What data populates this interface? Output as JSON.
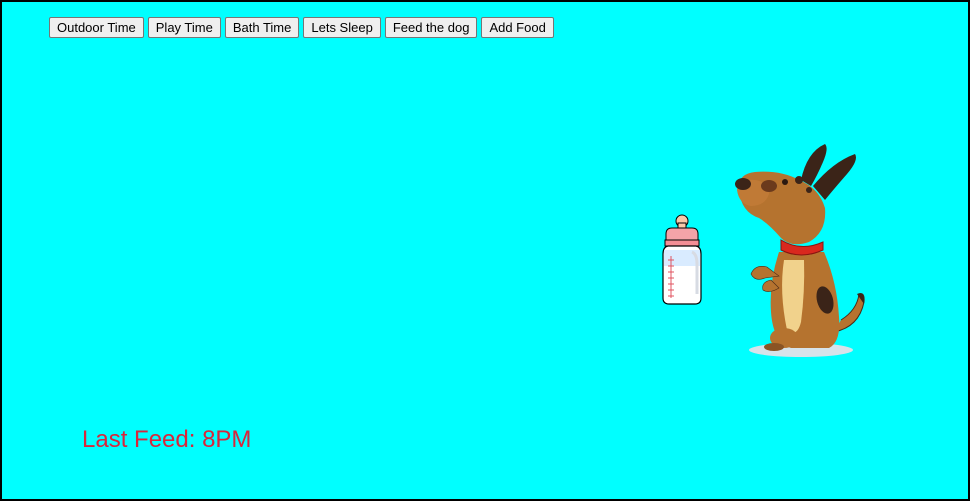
{
  "toolbar": {
    "buttons": [
      "Outdoor Time",
      "Play Time",
      "Bath Time",
      "Lets Sleep",
      "Feed the dog",
      "Add Food"
    ]
  },
  "status": {
    "last_feed": "Last Feed: 8PM"
  },
  "images": {
    "bottle": "milk-bottle-icon",
    "dog": "dog-illustration"
  },
  "colors": {
    "background": "#00ffff",
    "last_feed_text": "#d9263b"
  }
}
